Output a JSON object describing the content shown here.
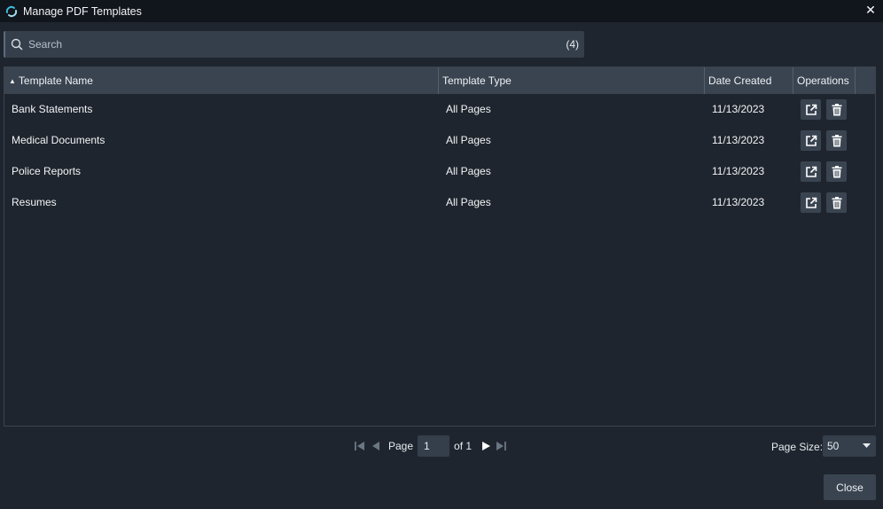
{
  "window": {
    "title": "Manage PDF Templates",
    "close_glyph": "✕"
  },
  "search": {
    "placeholder": "Search",
    "count": "(4)"
  },
  "grid": {
    "columns": [
      {
        "label": "Template Name",
        "sorted": "ascending"
      },
      {
        "label": "Template Type"
      },
      {
        "label": "Date Created"
      },
      {
        "label": "Operations"
      }
    ],
    "rows": [
      {
        "name": "Bank Statements",
        "type": "All Pages",
        "date": "11/13/2023"
      },
      {
        "name": "Medical Documents",
        "type": "All Pages",
        "date": "11/13/2023"
      },
      {
        "name": "Police Reports",
        "type": "All Pages",
        "date": "11/13/2023"
      },
      {
        "name": "Resumes",
        "type": "All Pages",
        "date": "11/13/2023"
      }
    ],
    "operations_icons": [
      "external-link-icon",
      "trash-icon"
    ]
  },
  "pager": {
    "page_label": "Page",
    "page_value": "1",
    "of_label": "of 1",
    "page_size_label": "Page Size:",
    "page_size_value": "50"
  },
  "footer": {
    "close_label": "Close"
  },
  "colors": {
    "background": "#1f252e",
    "titlebar": "#11161c",
    "header": "#3a4451",
    "accent_icon": "#3fb8d8"
  }
}
